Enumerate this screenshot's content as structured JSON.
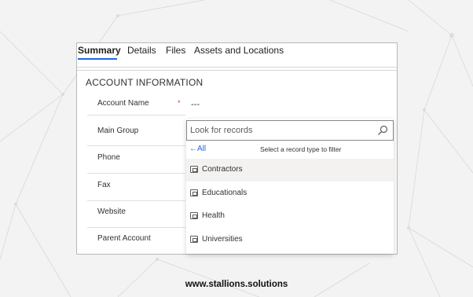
{
  "tabs": [
    "Summary",
    "Details",
    "Files",
    "Assets and Locations"
  ],
  "section_title": "ACCOUNT INFORMATION",
  "fields": [
    {
      "label": "Account Name",
      "value": "---",
      "required": "*"
    },
    {
      "label": "Main Group"
    },
    {
      "label": "Phone"
    },
    {
      "label": "Fax"
    },
    {
      "label": "Website"
    },
    {
      "label": "Parent Account"
    }
  ],
  "lookup": {
    "placeholder": "Look for records",
    "back_label": "All",
    "filter_text": "Select a record type to filter",
    "options": [
      "Contractors",
      "Educationals",
      "Health",
      "Universities"
    ]
  },
  "footer": "www.stallions.solutions",
  "colors": {
    "accent": "#2266e3",
    "required": "#d13438"
  }
}
